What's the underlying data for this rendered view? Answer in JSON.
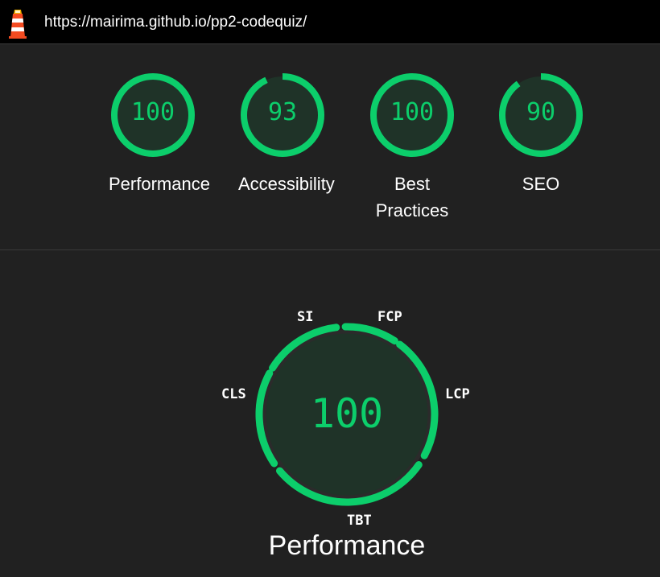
{
  "header": {
    "logo_icon": "lighthouse-icon",
    "url": "https://mairima.github.io/pp2-codequiz/"
  },
  "colors": {
    "pass": "#0cce6b",
    "gauge_fill": "#1f3328",
    "background": "#212121",
    "topbar": "#000000"
  },
  "categories": [
    {
      "key": "performance",
      "score": "100",
      "label": "Performance",
      "value": 100
    },
    {
      "key": "accessibility",
      "score": "93",
      "label": "Accessibility",
      "value": 93
    },
    {
      "key": "best-practices",
      "score": "100",
      "label": "Best Practices",
      "value": 100
    },
    {
      "key": "seo",
      "score": "90",
      "label": "SEO",
      "value": 90
    }
  ],
  "performance_detail": {
    "score": "100",
    "title": "Performance",
    "metrics": [
      {
        "key": "si",
        "label": "SI"
      },
      {
        "key": "fcp",
        "label": "FCP"
      },
      {
        "key": "lcp",
        "label": "LCP"
      },
      {
        "key": "tbt",
        "label": "TBT"
      },
      {
        "key": "cls",
        "label": "CLS"
      }
    ]
  }
}
